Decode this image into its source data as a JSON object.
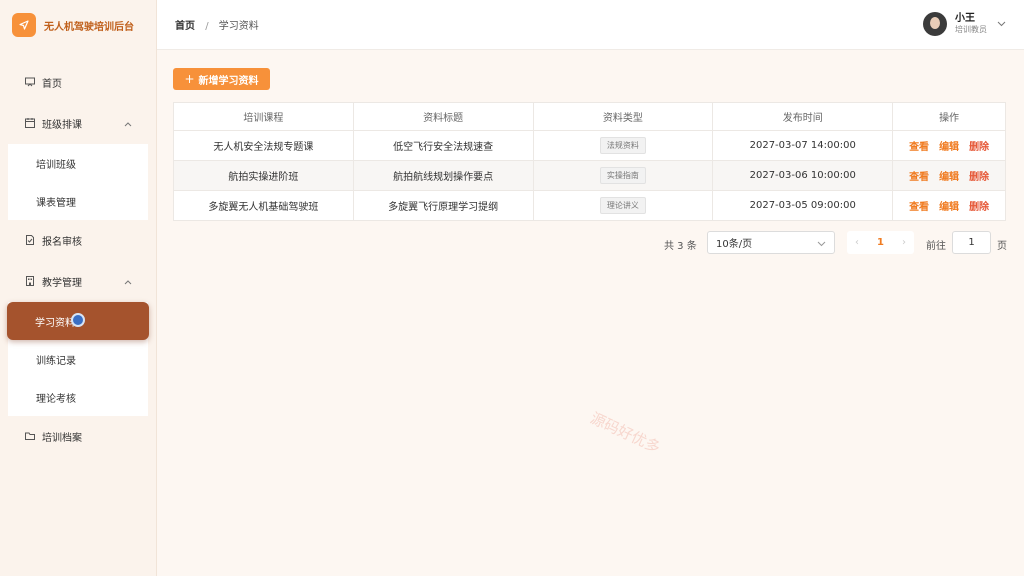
{
  "app": {
    "title": "无人机驾驶培训后台"
  },
  "sidebar": {
    "home": "首页",
    "class_group": {
      "label": "班级排课",
      "items": [
        "培训班级",
        "课表管理"
      ]
    },
    "enroll": "报名审核",
    "teaching_group": {
      "label": "教学管理",
      "items": [
        "学习资料",
        "训练记录",
        "理论考核"
      ]
    },
    "archive": "培训档案"
  },
  "breadcrumb": {
    "home": "首页",
    "separator": "/",
    "current": "学习资料"
  },
  "user": {
    "name": "小王",
    "role": "培训教员"
  },
  "toolbar": {
    "add_label": "新增学习资料",
    "add_icon": "+"
  },
  "table": {
    "headers": [
      "培训课程",
      "资料标题",
      "资料类型",
      "发布时间",
      "操作"
    ],
    "rows": [
      {
        "course": "无人机安全法规专题课",
        "title": "低空飞行安全法规速查",
        "type": "法规资料",
        "time": "2027-03-07 14:00:00"
      },
      {
        "course": "航拍实操进阶班",
        "title": "航拍航线规划操作要点",
        "type": "实操指南",
        "time": "2027-03-06 10:00:00"
      },
      {
        "course": "多旋翼无人机基础驾驶班",
        "title": "多旋翼飞行原理学习提纲",
        "type": "理论讲义",
        "time": "2027-03-05 09:00:00"
      }
    ],
    "actions": {
      "view": "查看",
      "edit": "编辑",
      "delete": "删除"
    }
  },
  "pagination": {
    "total": "共 3 条",
    "page_size": "10条/页",
    "prev": "‹",
    "current_page": "1",
    "next": "›",
    "goto_label": "前往",
    "goto_value": "1",
    "page_suffix": "页"
  },
  "watermark": {
    "text": "源码好优多"
  },
  "colors": {
    "accent": "#f7913a",
    "active_menu": "#a5532d",
    "delete": "#e65a3a"
  }
}
